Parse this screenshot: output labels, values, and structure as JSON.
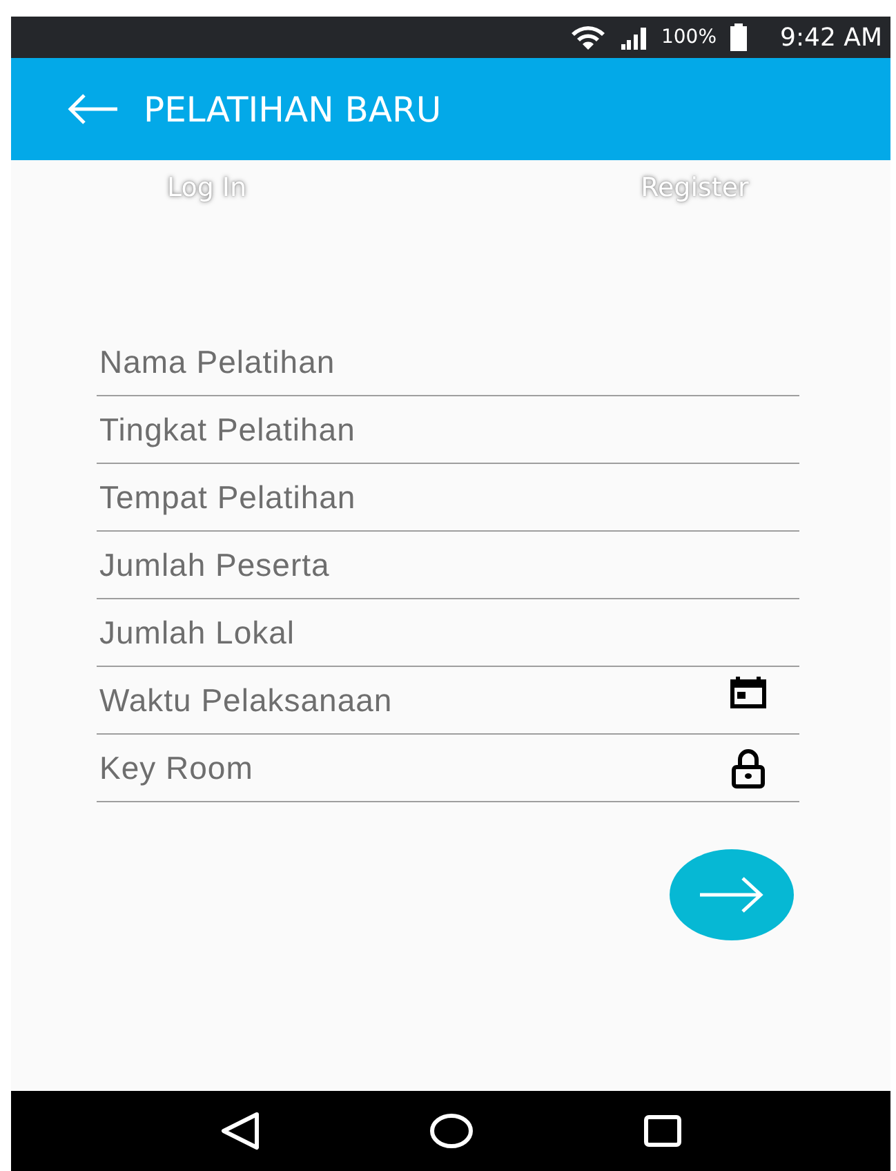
{
  "status_bar": {
    "battery": "100%",
    "time": "9:42 AM"
  },
  "app_bar": {
    "title": "PELATIHAN BARU"
  },
  "tabs": [
    {
      "label": "Log In"
    },
    {
      "label": "Register"
    }
  ],
  "fields": [
    {
      "placeholder": "Nama Pelatihan",
      "kind": "text"
    },
    {
      "placeholder": "Tingkat Pelatihan",
      "kind": "text"
    },
    {
      "placeholder": "Tempat Pelatihan",
      "kind": "text"
    },
    {
      "placeholder": "Jumlah Peserta",
      "kind": "text"
    },
    {
      "placeholder": "Jumlah Lokal",
      "kind": "text"
    },
    {
      "placeholder": "Waktu Pelaksanaan",
      "kind": "date"
    },
    {
      "placeholder": "Key Room",
      "kind": "password"
    }
  ]
}
